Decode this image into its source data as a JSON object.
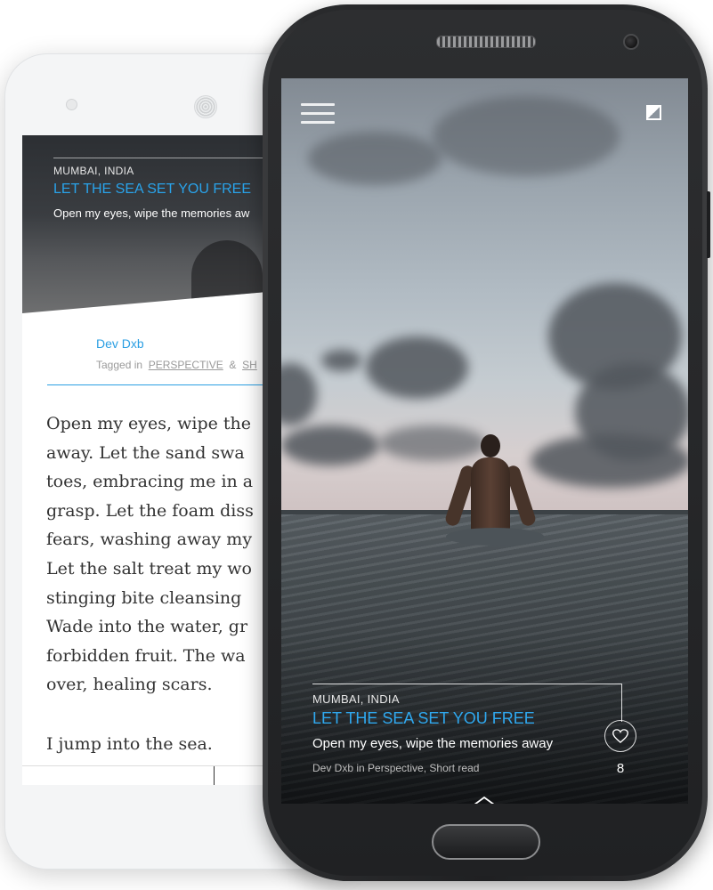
{
  "back_phone": {
    "story": {
      "location": "MUMBAI, INDIA",
      "title": "LET THE SEA SET YOU FREE",
      "subtitle": "Open my eyes, wipe the memories aw"
    },
    "author": "Dev Dxb",
    "tagged_prefix": "Tagged in",
    "tags": [
      "PERSPECTIVE",
      "SH"
    ],
    "tag_separator": "&",
    "body_paragraphs": [
      [
        "Open my eyes, wipe the",
        "away. Let the sand swa",
        "toes, embracing me in a",
        "grasp. Let the foam diss",
        "fears, washing away my",
        "Let the salt treat my wo",
        "stinging bite cleansing",
        "Wade into the water, gr",
        "forbidden fruit. The wa",
        "over, healing scars."
      ],
      [
        "I jump into the sea."
      ]
    ]
  },
  "front_phone": {
    "story": {
      "location": "MUMBAI, INDIA",
      "title": "LET THE SEA SET YOU FREE",
      "subtitle": "Open my eyes, wipe the memories away",
      "byline": "Dev Dxb in Perspective, Short read"
    },
    "like_count": "8",
    "icons": {
      "menu": "hamburger-menu-icon",
      "logo": "app-logo-icon",
      "like": "heart-icon",
      "expand": "chevron-up-icon"
    }
  },
  "colors": {
    "accent": "#2fa8ef",
    "link_blue": "#2b9fe3",
    "phone_dark": "#222325",
    "phone_white": "#f4f5f6"
  }
}
